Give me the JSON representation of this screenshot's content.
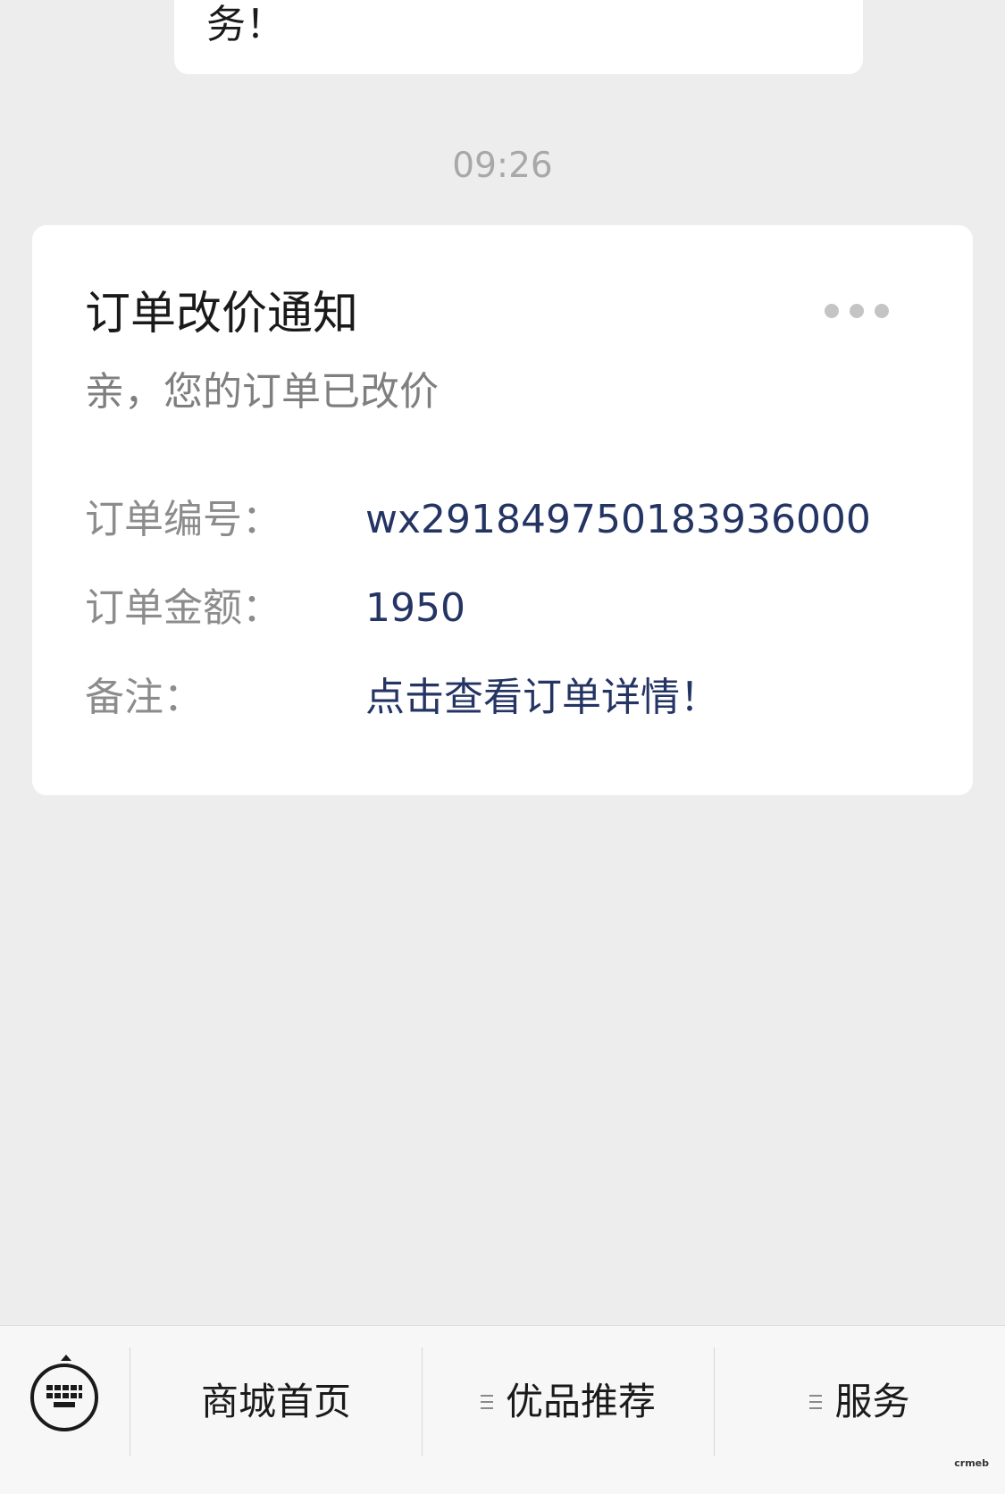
{
  "previous_message": {
    "text": "务！"
  },
  "timestamp": "09:26",
  "notification": {
    "title": "订单改价通知",
    "subtitle": "亲，您的订单已改价",
    "more_icon": "more-dots-icon",
    "fields": [
      {
        "label": "订单编号：",
        "value": "wx291849750183936000"
      },
      {
        "label": "订单金额：",
        "value": "1950"
      },
      {
        "label": "备注：",
        "value": "点击查看订单详情！"
      }
    ]
  },
  "bottom_menu": {
    "keyboard_icon": "keyboard-icon",
    "items": [
      {
        "label": "商城首页",
        "has_submenu": false
      },
      {
        "label": "优品推荐",
        "has_submenu": true
      },
      {
        "label": "服务",
        "has_submenu": true
      }
    ]
  },
  "watermark": "crmeb",
  "colors": {
    "background": "#ededed",
    "card": "#ffffff",
    "value_text": "#243463",
    "label_text": "#8c8c8c",
    "timestamp_text": "#a8a8a8"
  }
}
